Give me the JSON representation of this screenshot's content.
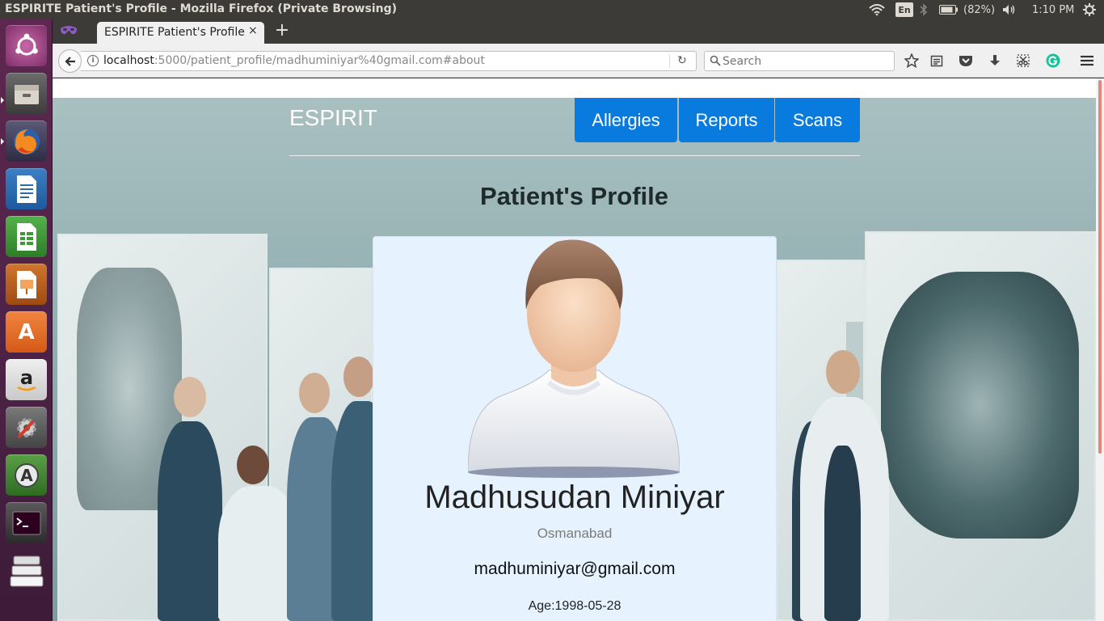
{
  "os_panel": {
    "window_title": "ESPIRITE Patient's Profile - Mozilla Firefox (Private Browsing)",
    "keyboard_layout": "En",
    "battery": "(82%)",
    "clock": "1:10 PM"
  },
  "launcher": {
    "items": [
      "ubuntu-dash",
      "files",
      "firefox",
      "libreoffice-writer",
      "libreoffice-calc",
      "libreoffice-impress",
      "ubuntu-software",
      "amazon",
      "system-settings",
      "software-updater",
      "terminal",
      "workspace-switcher"
    ]
  },
  "browser": {
    "tab_title": "ESPIRITE Patient's Profile",
    "tab_close": "×",
    "new_tab": "+",
    "url_host": "localhost",
    "url_rest": ":5000/patient_profile/madhuminiyar%40gmail.com#about",
    "search_placeholder": "Search",
    "reload": "↻"
  },
  "site": {
    "brand": "ESPIRIT",
    "nav": {
      "allergies": "Allergies",
      "reports": "Reports",
      "scans": "Scans"
    },
    "heading": "Patient's Profile"
  },
  "profile": {
    "name": "Madhusudan Miniyar",
    "city": "Osmanabad",
    "email": "madhuminiyar@gmail.com",
    "age": "Age:1998-05-28"
  },
  "colors": {
    "nav_button": "#0a7bde",
    "card_bg": "#e6f2fd",
    "launcher": "#5e2750"
  }
}
